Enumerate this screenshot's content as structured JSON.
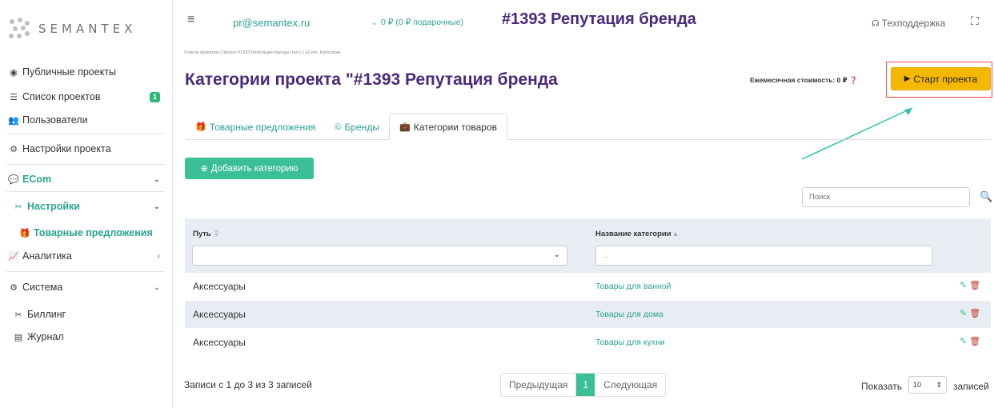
{
  "brand": {
    "logo_text": "SEMANTEX"
  },
  "sidebar": {
    "items": [
      {
        "label": "Публичные проекты",
        "icon": "eye-icon"
      },
      {
        "label": "Список проектов",
        "icon": "list-icon",
        "badge": "1"
      },
      {
        "label": "Пользователи",
        "icon": "users-icon"
      },
      {
        "label": "Настройки проекта",
        "icon": "cogs-icon"
      },
      {
        "label": "ECom",
        "icon": "comments-icon"
      },
      {
        "label": "Настройки",
        "icon": "tools-icon"
      },
      {
        "label": "Товарные предложения",
        "icon": "gift-icon"
      },
      {
        "label": "Аналитика",
        "icon": "chart-line-icon"
      },
      {
        "label": "Система",
        "icon": "cogs-icon"
      },
      {
        "label": "Биллинг",
        "icon": "tools-icon"
      },
      {
        "label": "Журнал",
        "icon": "newspaper-icon"
      }
    ]
  },
  "topbar": {
    "email": "pr@semantex.ru",
    "balance": "0 ₽ (0 ₽ подарочные)",
    "project_title": "#1393 Репутация бренда",
    "support_label": "Техподдержка"
  },
  "breadcrumb": "Список проектов  |  Проект #1393 Репутация бренда (тест)  |  ECom: Категории",
  "page_title": "Категории проекта \"#1393 Репутация бренда",
  "monthly_cost": "Ежемесячная стоимость: 0 ₽",
  "start_button": "Старт проекта",
  "tabs": [
    {
      "label": "Товарные предложения",
      "icon": "gift-icon"
    },
    {
      "label": "Бренды",
      "icon": "copyright-icon"
    },
    {
      "label": "Категории товаров",
      "icon": "briefcase-icon"
    }
  ],
  "add_button": "Добавить категорию",
  "search": {
    "placeholder": "Поиск"
  },
  "table": {
    "columns": [
      "Путь",
      "Название категории"
    ],
    "name_filter_placeholder": "...",
    "rows": [
      {
        "path": "Аксессуары",
        "name": "Товары для ванной"
      },
      {
        "path": "Аксессуары",
        "name": "Товары для дома"
      },
      {
        "path": "Аксессуары",
        "name": "Товары для кухни"
      }
    ]
  },
  "footer": {
    "records_info": "Записи с 1 до 3 из 3 записей",
    "prev": "Предыдущая",
    "current_page": "1",
    "next": "Следующая",
    "show_label": "Показать",
    "page_size": "10",
    "entries_label": "записей"
  },
  "colors": {
    "accent": "#2aa38f",
    "title": "#4b2a7a",
    "start": "#f5b800",
    "highlight": "#f04a4a"
  }
}
